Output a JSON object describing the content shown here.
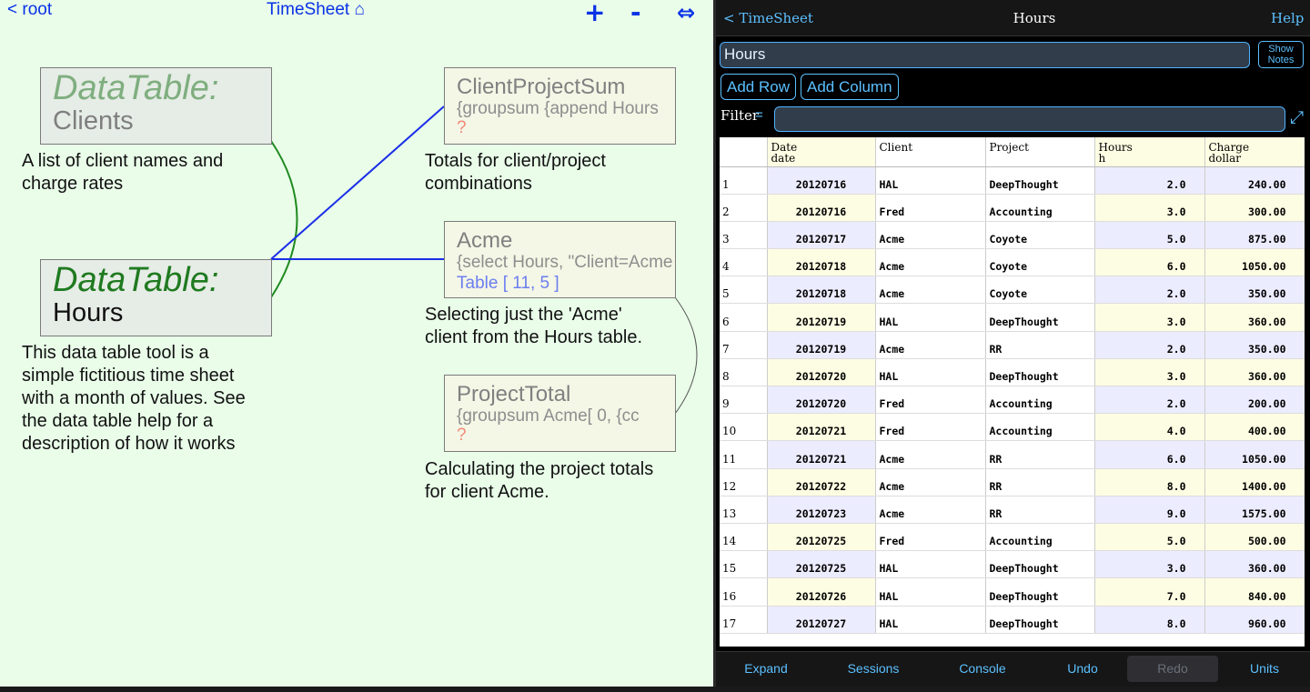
{
  "left": {
    "nav": {
      "back": "< root",
      "title": "TimeSheet ⌂",
      "zoom_in": "+",
      "zoom_out": "-",
      "fit": "⇔"
    },
    "nodes": {
      "clients": {
        "type": "DataTable:",
        "name": "Clients",
        "desc_lines": [
          "A list of client names and",
          "charge rates"
        ]
      },
      "hours": {
        "type": "DataTable:",
        "name": "Hours",
        "desc_lines": [
          "This data table tool is a",
          "simple fictitious time sheet",
          "with a month of values. See",
          "the data table help for a",
          "description of how it works"
        ]
      },
      "client_project_sum": {
        "name": "ClientProjectSum",
        "expr": "{groupsum {append Hours",
        "value": "?",
        "desc_lines": [
          "Totals for client/project",
          "combinations"
        ]
      },
      "acme": {
        "name": "Acme",
        "expr": "{select Hours, \"Client=Acme",
        "value": "Table [ 11, 5 ]",
        "desc_lines": [
          "Selecting just the 'Acme'",
          "client from the Hours table."
        ]
      },
      "project_total": {
        "name": "ProjectTotal",
        "expr": "{groupsum Acme[ 0, {cc",
        "value": "?",
        "desc_lines": [
          "Calculating the project totals",
          "for client Acme."
        ]
      }
    },
    "colors": {
      "link": "#0a32e6",
      "dt_clients": "#7fae7f",
      "dt_hours": "#1f7a1f",
      "wire_green": "#1f8a1f",
      "wire_blue": "#1a2ee8"
    }
  },
  "right": {
    "header": {
      "back": "< TimeSheet",
      "title": "Hours",
      "help": "Help"
    },
    "name_value": "Hours",
    "show_notes": [
      "Show",
      "Notes"
    ],
    "add_row": "Add Row",
    "add_column": "Add Column",
    "filter_label": "Filter",
    "filter_eq": "=",
    "filter_value": "",
    "expand_icon": "⤢",
    "columns": [
      {
        "name": "Date",
        "unit": "date"
      },
      {
        "name": "Client",
        "unit": ""
      },
      {
        "name": "Project",
        "unit": ""
      },
      {
        "name": "Hours",
        "unit": "h"
      },
      {
        "name": "Charge",
        "unit": "dollar"
      }
    ],
    "rows": [
      [
        "20120716",
        "HAL",
        "DeepThought",
        "2.0",
        "240.00"
      ],
      [
        "20120716",
        "Fred",
        "Accounting",
        "3.0",
        "300.00"
      ],
      [
        "20120717",
        "Acme",
        "Coyote",
        "5.0",
        "875.00"
      ],
      [
        "20120718",
        "Acme",
        "Coyote",
        "6.0",
        "1050.00"
      ],
      [
        "20120718",
        "Acme",
        "Coyote",
        "2.0",
        "350.00"
      ],
      [
        "20120719",
        "HAL",
        "DeepThought",
        "3.0",
        "360.00"
      ],
      [
        "20120719",
        "Acme",
        "RR",
        "2.0",
        "350.00"
      ],
      [
        "20120720",
        "HAL",
        "DeepThought",
        "3.0",
        "360.00"
      ],
      [
        "20120720",
        "Fred",
        "Accounting",
        "2.0",
        "200.00"
      ],
      [
        "20120721",
        "Fred",
        "Accounting",
        "4.0",
        "400.00"
      ],
      [
        "20120721",
        "Acme",
        "RR",
        "6.0",
        "1050.00"
      ],
      [
        "20120722",
        "Acme",
        "RR",
        "8.0",
        "1400.00"
      ],
      [
        "20120723",
        "Acme",
        "RR",
        "9.0",
        "1575.00"
      ],
      [
        "20120725",
        "Fred",
        "Accounting",
        "5.0",
        "500.00"
      ],
      [
        "20120725",
        "HAL",
        "DeepThought",
        "3.0",
        "360.00"
      ],
      [
        "20120726",
        "HAL",
        "DeepThought",
        "7.0",
        "840.00"
      ],
      [
        "20120727",
        "HAL",
        "DeepThought",
        "8.0",
        "960.00"
      ]
    ],
    "bottom": {
      "expand": "Expand",
      "sessions": "Sessions",
      "console": "Console",
      "undo": "Undo",
      "redo": "Redo",
      "units": "Units"
    },
    "colors": {
      "accent": "#5cc0ff",
      "header_bg": "#161616",
      "input_bg": "#313d4a"
    }
  }
}
